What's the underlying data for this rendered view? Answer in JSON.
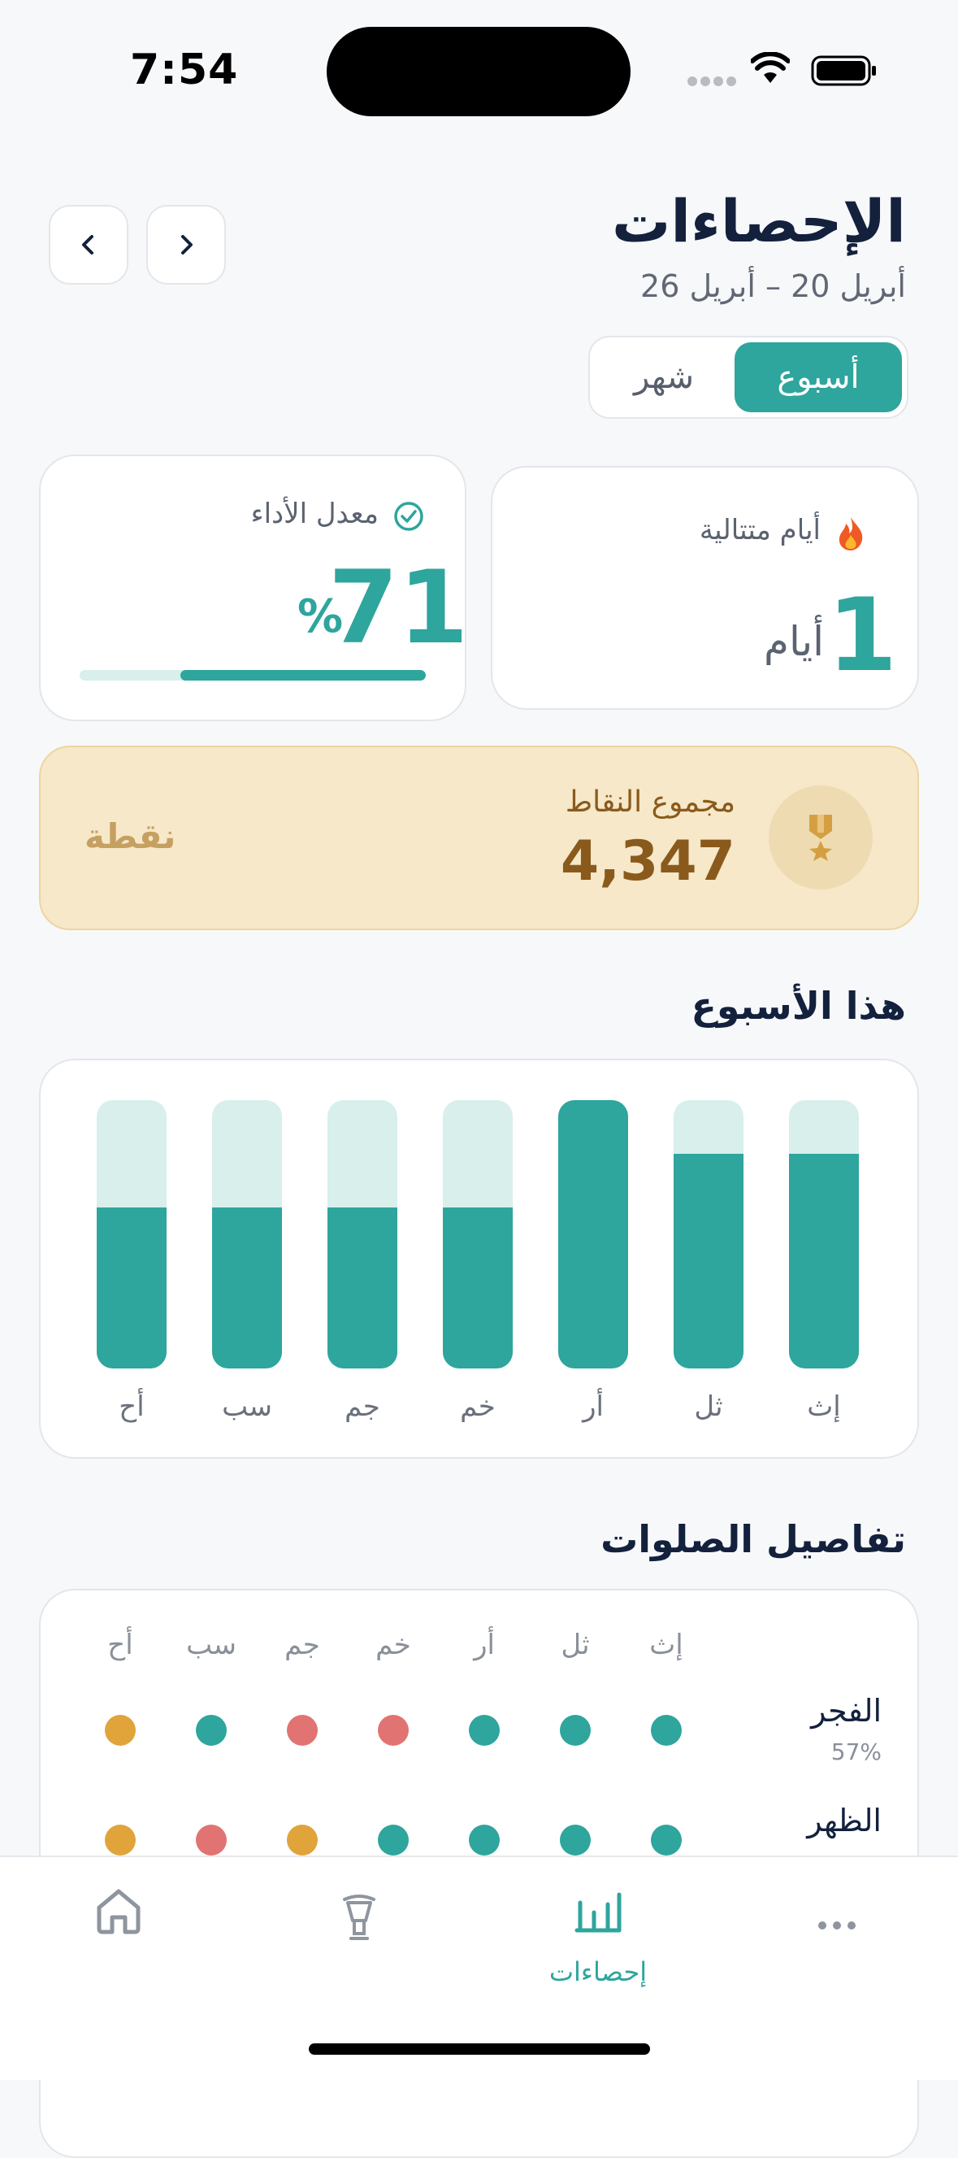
{
  "status_bar": {
    "time": "7:54"
  },
  "header": {
    "title": "الإحصاءات",
    "date_range": "أبريل 20 – أبريل 26",
    "segments": {
      "week": "أسبوع",
      "month": "شهر",
      "active": "week"
    }
  },
  "streak_card": {
    "label": "أيام متتالية",
    "value": "1",
    "unit": "أيام",
    "icon": "fire-icon"
  },
  "performance_card": {
    "label": "معدل الأداء",
    "value": "71",
    "unit": "%",
    "progress": 0.71,
    "icon": "check-circle-icon"
  },
  "points_card": {
    "label": "مجموع النقاط",
    "value": "4,347",
    "unit": "نقطة",
    "icon": "medal-icon"
  },
  "week_section": {
    "title": "هذا الأسبوع"
  },
  "chart_data": {
    "type": "bar",
    "categories": [
      "إث",
      "ثل",
      "أر",
      "خم",
      "جم",
      "سب",
      "أح"
    ],
    "values": [
      0.8,
      0.8,
      1.0,
      0.6,
      0.6,
      0.6,
      0.6
    ],
    "ylim": [
      0,
      1
    ],
    "title": "",
    "xlabel": "",
    "ylabel": "",
    "grid": false
  },
  "prayer_section": {
    "title": "تفاصيل الصلوات",
    "days": [
      "إث",
      "ثل",
      "أر",
      "خم",
      "جم",
      "سب",
      "أح"
    ],
    "rows": [
      {
        "name": "الفجر",
        "percent": "57%",
        "status": [
          "green",
          "green",
          "green",
          "red",
          "red",
          "green",
          "orange"
        ]
      },
      {
        "name": "الظهر",
        "percent": "",
        "status": [
          "green",
          "green",
          "green",
          "green",
          "orange",
          "red",
          "orange"
        ]
      }
    ]
  },
  "colors": {
    "accent": "#2ea59d",
    "accent_light": "#d8efec",
    "green": "#2ea59d",
    "red": "#e27373",
    "orange": "#e0a43b",
    "gold_text": "#8a5a1c"
  },
  "tabbar": {
    "items": [
      {
        "id": "more",
        "label": "",
        "icon": "more-icon"
      },
      {
        "id": "stats",
        "label": "إحصاءات",
        "icon": "stats-icon",
        "active": true
      },
      {
        "id": "lantern",
        "label": "",
        "icon": "lantern-icon"
      },
      {
        "id": "home",
        "label": "",
        "icon": "home-icon"
      }
    ]
  }
}
